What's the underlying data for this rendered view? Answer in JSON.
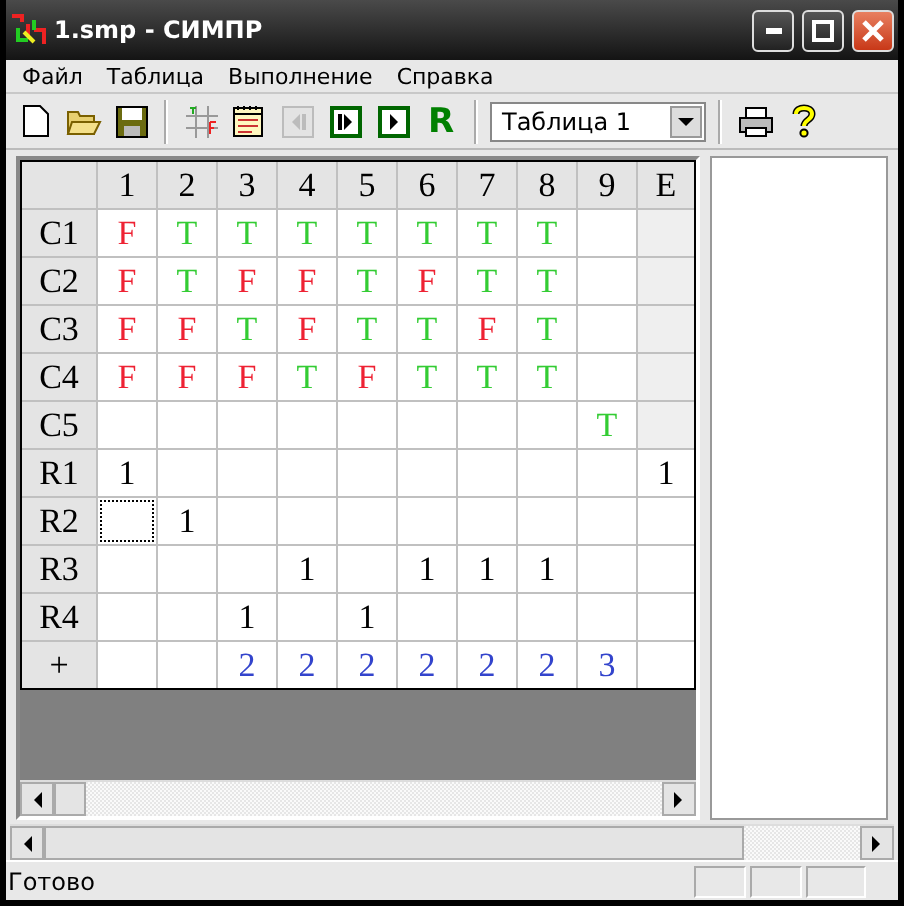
{
  "window": {
    "title": "1.smp - СИМПР"
  },
  "menu": [
    "Файл",
    "Таблица",
    "Выполнение",
    "Справка"
  ],
  "toolbar": [
    {
      "kind": "new",
      "disabled": false
    },
    {
      "kind": "open",
      "disabled": false
    },
    {
      "kind": "save",
      "disabled": false
    },
    {
      "kind": "sep"
    },
    {
      "kind": "tf-table",
      "disabled": false
    },
    {
      "kind": "notes",
      "disabled": false
    },
    {
      "kind": "step-back",
      "disabled": true
    },
    {
      "kind": "step",
      "disabled": false
    },
    {
      "kind": "play",
      "disabled": false
    },
    {
      "kind": "letter",
      "text": "R",
      "disabled": false
    },
    {
      "kind": "sep"
    },
    {
      "kind": "combo",
      "value": "Таблица  1"
    },
    {
      "kind": "sep"
    },
    {
      "kind": "print",
      "disabled": false
    },
    {
      "kind": "help",
      "disabled": false
    }
  ],
  "table": {
    "columns": [
      "1",
      "2",
      "3",
      "4",
      "5",
      "6",
      "7",
      "8",
      "9",
      "E"
    ],
    "rows": [
      {
        "header": "C1",
        "kind": "condition",
        "cells": [
          {
            "kind": "false",
            "text": "F"
          },
          {
            "kind": "true",
            "text": "T"
          },
          {
            "kind": "true",
            "text": "T"
          },
          {
            "kind": "true",
            "text": "T"
          },
          {
            "kind": "true",
            "text": "T"
          },
          {
            "kind": "true",
            "text": "T"
          },
          {
            "kind": "true",
            "text": "T"
          },
          {
            "kind": "true",
            "text": "T"
          },
          {
            "kind": "empty"
          },
          {
            "kind": "empty"
          }
        ]
      },
      {
        "header": "C2",
        "kind": "condition",
        "cells": [
          {
            "kind": "false",
            "text": "F"
          },
          {
            "kind": "true",
            "text": "T"
          },
          {
            "kind": "false",
            "text": "F"
          },
          {
            "kind": "false",
            "text": "F"
          },
          {
            "kind": "true",
            "text": "T"
          },
          {
            "kind": "false",
            "text": "F"
          },
          {
            "kind": "true",
            "text": "T"
          },
          {
            "kind": "true",
            "text": "T"
          },
          {
            "kind": "empty"
          },
          {
            "kind": "empty"
          }
        ]
      },
      {
        "header": "C3",
        "kind": "condition",
        "cells": [
          {
            "kind": "false",
            "text": "F"
          },
          {
            "kind": "false",
            "text": "F"
          },
          {
            "kind": "true",
            "text": "T"
          },
          {
            "kind": "false",
            "text": "F"
          },
          {
            "kind": "true",
            "text": "T"
          },
          {
            "kind": "true",
            "text": "T"
          },
          {
            "kind": "false",
            "text": "F"
          },
          {
            "kind": "true",
            "text": "T"
          },
          {
            "kind": "empty"
          },
          {
            "kind": "empty"
          }
        ]
      },
      {
        "header": "C4",
        "kind": "condition",
        "cells": [
          {
            "kind": "false",
            "text": "F"
          },
          {
            "kind": "false",
            "text": "F"
          },
          {
            "kind": "false",
            "text": "F"
          },
          {
            "kind": "true",
            "text": "T"
          },
          {
            "kind": "false",
            "text": "F"
          },
          {
            "kind": "true",
            "text": "T"
          },
          {
            "kind": "true",
            "text": "T"
          },
          {
            "kind": "true",
            "text": "T"
          },
          {
            "kind": "empty"
          },
          {
            "kind": "empty"
          }
        ]
      },
      {
        "header": "C5",
        "kind": "condition",
        "cells": [
          {
            "kind": "empty"
          },
          {
            "kind": "empty"
          },
          {
            "kind": "empty"
          },
          {
            "kind": "empty"
          },
          {
            "kind": "empty"
          },
          {
            "kind": "empty"
          },
          {
            "kind": "empty"
          },
          {
            "kind": "empty"
          },
          {
            "kind": "true",
            "text": "T"
          },
          {
            "kind": "empty"
          }
        ]
      },
      {
        "header": "R1",
        "kind": "rule",
        "cells": [
          {
            "kind": "value",
            "text": "1"
          },
          {
            "kind": "empty"
          },
          {
            "kind": "empty"
          },
          {
            "kind": "empty"
          },
          {
            "kind": "empty"
          },
          {
            "kind": "empty"
          },
          {
            "kind": "empty"
          },
          {
            "kind": "empty"
          },
          {
            "kind": "empty"
          },
          {
            "kind": "value",
            "text": "1"
          }
        ]
      },
      {
        "header": "R2",
        "kind": "rule",
        "cells": [
          {
            "kind": "empty",
            "focused": true
          },
          {
            "kind": "value",
            "text": "1"
          },
          {
            "kind": "empty"
          },
          {
            "kind": "empty"
          },
          {
            "kind": "empty"
          },
          {
            "kind": "empty"
          },
          {
            "kind": "empty"
          },
          {
            "kind": "empty"
          },
          {
            "kind": "empty"
          },
          {
            "kind": "empty"
          }
        ]
      },
      {
        "header": "R3",
        "kind": "rule",
        "cells": [
          {
            "kind": "empty"
          },
          {
            "kind": "empty"
          },
          {
            "kind": "empty"
          },
          {
            "kind": "value",
            "text": "1"
          },
          {
            "kind": "empty"
          },
          {
            "kind": "value",
            "text": "1"
          },
          {
            "kind": "value",
            "text": "1"
          },
          {
            "kind": "value",
            "text": "1"
          },
          {
            "kind": "empty"
          },
          {
            "kind": "empty"
          }
        ]
      },
      {
        "header": "R4",
        "kind": "rule",
        "cells": [
          {
            "kind": "empty"
          },
          {
            "kind": "empty"
          },
          {
            "kind": "value",
            "text": "1"
          },
          {
            "kind": "empty"
          },
          {
            "kind": "value",
            "text": "1"
          },
          {
            "kind": "empty"
          },
          {
            "kind": "empty"
          },
          {
            "kind": "empty"
          },
          {
            "kind": "empty"
          },
          {
            "kind": "empty"
          }
        ]
      },
      {
        "header": "+",
        "kind": "sum",
        "cells": [
          {
            "kind": "empty"
          },
          {
            "kind": "empty"
          },
          {
            "kind": "count",
            "text": "2"
          },
          {
            "kind": "count",
            "text": "2"
          },
          {
            "kind": "count",
            "text": "2"
          },
          {
            "kind": "count",
            "text": "2"
          },
          {
            "kind": "count",
            "text": "2"
          },
          {
            "kind": "count",
            "text": "2"
          },
          {
            "kind": "count",
            "text": "3"
          },
          {
            "kind": "empty"
          }
        ]
      }
    ]
  },
  "status_bar": {
    "text": "Готово"
  }
}
